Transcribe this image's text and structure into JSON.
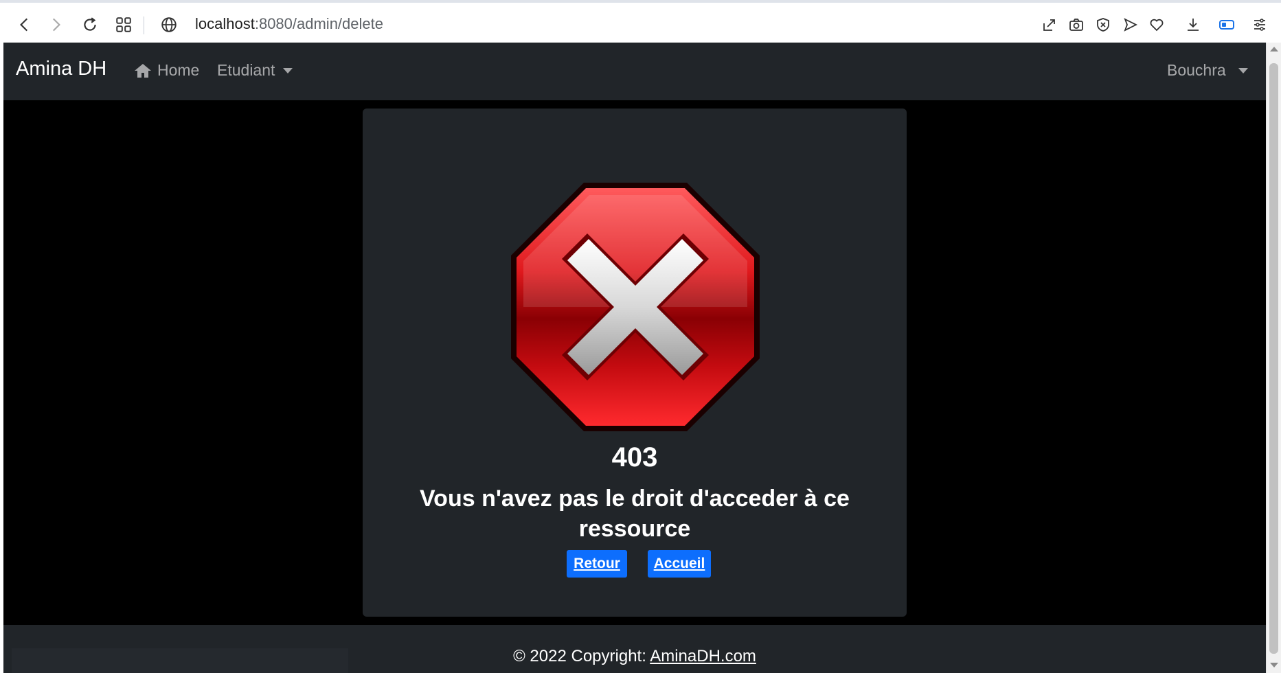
{
  "browser": {
    "url_host": "localhost",
    "url_path": ":8080/admin/delete",
    "icons": [
      "back-icon",
      "forward-icon",
      "reload-icon",
      "tabs-grid-icon",
      "globe-icon",
      "share-icon",
      "camera-icon",
      "shield-x-icon",
      "send-icon",
      "heart-icon",
      "download-icon",
      "sidebar-icon",
      "menu-icon"
    ]
  },
  "navbar": {
    "brand": "Amina DH",
    "home_label": "Home",
    "etudiant_label": "Etudiant",
    "user_label": "Bouchra"
  },
  "error": {
    "code": "403",
    "message": "Vous n'avez pas le droit d'acceder à ce ressource",
    "back_label": "Retour",
    "home_label": "Accueil"
  },
  "footer": {
    "copyright_prefix": "© 2022 Copyright: ",
    "copyright_link": "AminaDH.com"
  },
  "colors": {
    "navbar_bg": "#212529",
    "page_bg": "#000000",
    "button_bg": "#0d6efd",
    "stop_red": "#d40f12"
  }
}
